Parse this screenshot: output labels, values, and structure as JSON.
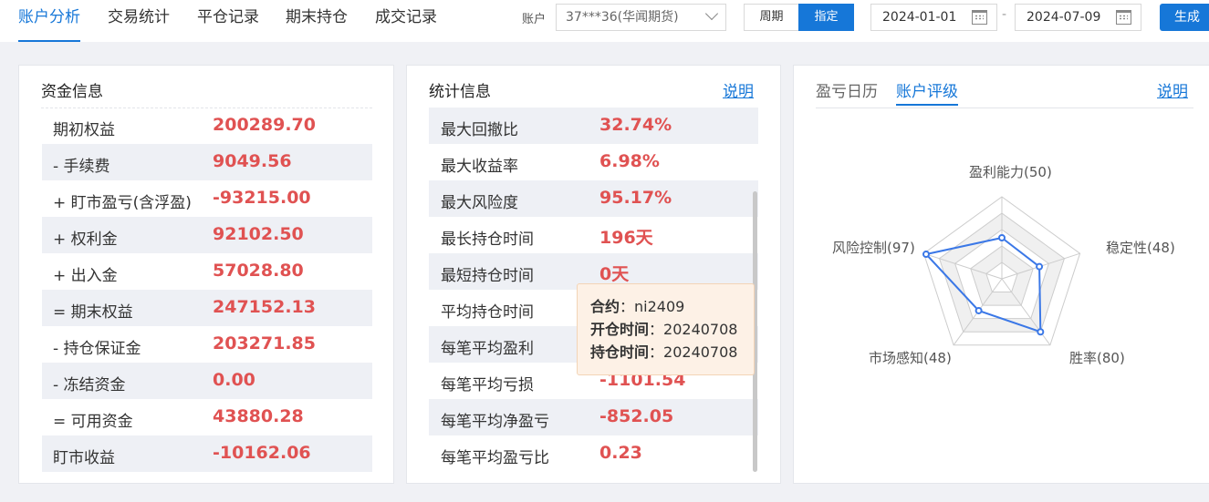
{
  "nav": {
    "tabs": [
      "账户分析",
      "交易统计",
      "平仓记录",
      "期末持仓",
      "成交记录"
    ]
  },
  "toolbar": {
    "account_label": "账户",
    "account_value": "37***36(华闻期货)",
    "mode_period": "周期",
    "mode_custom": "指定",
    "date_start": "2024-01-01",
    "date_sep": "-",
    "date_end": "2024-07-09",
    "generate": "生成"
  },
  "funds": {
    "title": "资金信息",
    "rows": [
      {
        "label": "期初权益",
        "value": "200289.70"
      },
      {
        "label": "- 手续费",
        "value": "9049.56"
      },
      {
        "label": "+ 盯市盈亏(含浮盈)",
        "value": "-93215.00"
      },
      {
        "label": "+ 权利金",
        "value": "92102.50"
      },
      {
        "label": "+ 出入金",
        "value": "57028.80"
      },
      {
        "label": "= 期末权益",
        "value": "247152.13"
      },
      {
        "label": "- 持仓保证金",
        "value": "203271.85"
      },
      {
        "label": "- 冻结资金",
        "value": "0.00"
      },
      {
        "label": "= 可用资金",
        "value": "43880.28"
      },
      {
        "label": "盯市收益",
        "value": "-10162.06"
      }
    ]
  },
  "stats": {
    "title": "统计信息",
    "help": "说明",
    "rows": [
      {
        "label": "最大回撤比",
        "value": "32.74%"
      },
      {
        "label": "最大收益率",
        "value": "6.98%"
      },
      {
        "label": "最大风险度",
        "value": "95.17%"
      },
      {
        "label": "最长持仓时间",
        "value": "196天"
      },
      {
        "label": "最短持仓时间",
        "value": "0天"
      },
      {
        "label": "平均持仓时间",
        "value": ""
      },
      {
        "label": "每笔平均盈利",
        "value": ""
      },
      {
        "label": "每笔平均亏损",
        "value": "-1101.54"
      },
      {
        "label": "每笔平均净盈亏",
        "value": "-852.05"
      },
      {
        "label": "每笔平均盈亏比",
        "value": "0.23"
      }
    ]
  },
  "tooltip": {
    "contract_label": "合约",
    "contract_value": "ni2409",
    "open_label": "开仓时间",
    "open_value": "20240708",
    "hold_label": "持仓时间",
    "hold_value": "20240708"
  },
  "rating": {
    "tabs": [
      "盈亏日历",
      "账户评级"
    ],
    "help": "说明",
    "axes": [
      {
        "label": "盈利能力(50)",
        "value": 50
      },
      {
        "label": "稳定性(48)",
        "value": 48
      },
      {
        "label": "胜率(80)",
        "value": 80
      },
      {
        "label": "市场感知(48)",
        "value": 48
      },
      {
        "label": "风险控制(97)",
        "value": 97
      }
    ],
    "max": 100,
    "line_color": "#3b78e7"
  }
}
